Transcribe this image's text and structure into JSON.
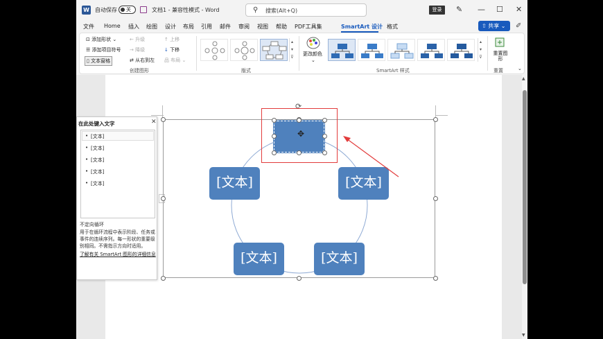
{
  "titlebar": {
    "autosave_label": "自动保存",
    "autosave_state": "关",
    "doc_title": "文档1 - 兼容性模式 - Word",
    "search_placeholder": "搜索(Alt+Q)",
    "login": "登录"
  },
  "tabs": [
    {
      "label": "文件"
    },
    {
      "label": "Home"
    },
    {
      "label": "插入"
    },
    {
      "label": "绘图"
    },
    {
      "label": "设计"
    },
    {
      "label": "布局"
    },
    {
      "label": "引用"
    },
    {
      "label": "邮件"
    },
    {
      "label": "审阅"
    },
    {
      "label": "视图"
    },
    {
      "label": "帮助"
    },
    {
      "label": "PDF工具集"
    },
    {
      "label": "SmartArt 设计"
    },
    {
      "label": "格式"
    }
  ],
  "share_label": "共享",
  "ribbon": {
    "create": {
      "add_shape": "添加形状",
      "add_bullet": "添加项目符号",
      "text_pane": "文本窗格",
      "promote": "升级",
      "demote": "降级",
      "right_to_left": "从右到左",
      "move_up": "上移",
      "move_down": "下移",
      "layout_btn": "布局",
      "group_label": "创建图形"
    },
    "layouts_label": "版式",
    "change_colors": "更改颜色",
    "styles_label": "SmartArt 样式",
    "reset_graphic": "重置图形",
    "reset_label": "重置"
  },
  "text_pane": {
    "title": "在此处键入文字",
    "items": [
      "[文本]",
      "[文本]",
      "[文本]",
      "[文本]",
      "[文本]"
    ],
    "desc_title": "不定向循环",
    "desc_body": "用于在循环流程中表示阶段、任务或事件的连续序列。每一形状的重要级别相同。不需指示方向时适用。",
    "learn_more": "了解有关 SmartArt 图形的详细信息"
  },
  "smartart": {
    "nodes": [
      "",
      "[文本]",
      "[文本]",
      "[文本]",
      "[文本]"
    ]
  },
  "colors": {
    "accent": "#185abd",
    "node_fill": "#4f81bd",
    "annotation": "#e23b3b"
  }
}
